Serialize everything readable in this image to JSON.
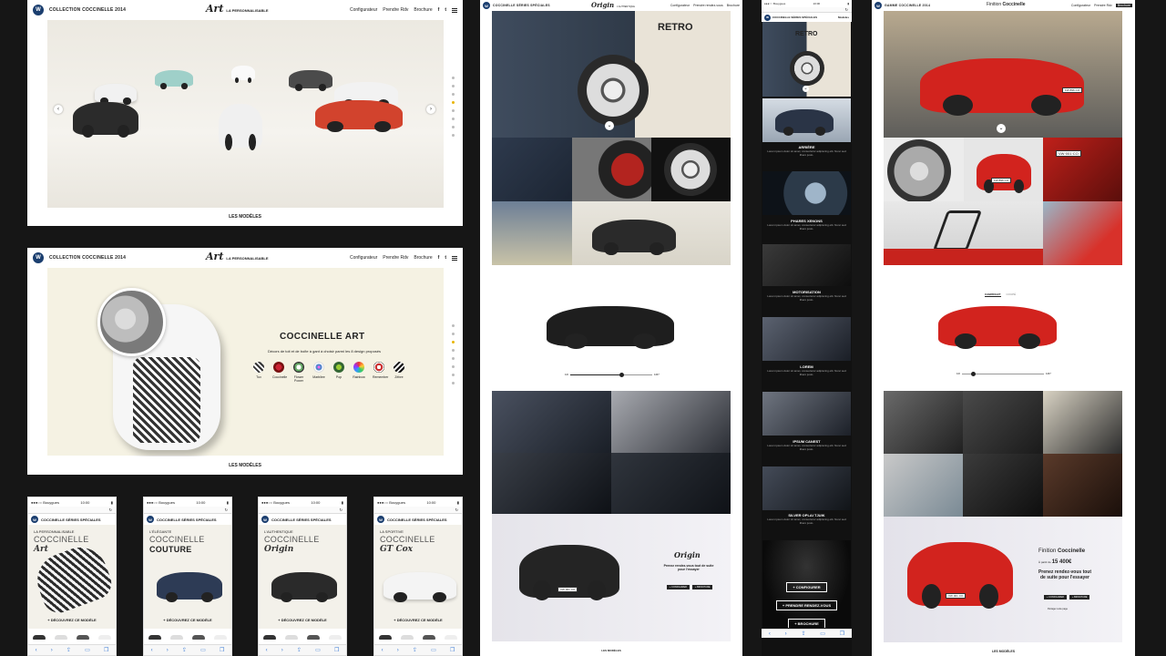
{
  "panel1": {
    "brand": "COLLECTION COCCINELLE 2014",
    "logo_script": "Art",
    "logo_sub": "LA PERSONNALISABLE",
    "nav": [
      "Configurateur",
      "Prendre Rdv",
      "Brochure"
    ],
    "social": [
      "f",
      "t"
    ],
    "prev_icon": "‹",
    "next_icon": "›",
    "footer": "LES MODÈLES"
  },
  "panel2": {
    "brand": "COLLECTION COCCINELLE 2014",
    "logo_script": "Art",
    "logo_sub": "LA PERSONNALISABLE",
    "nav": [
      "Configurateur",
      "Prendre Rdv",
      "Brochure"
    ],
    "social": [
      "f",
      "t"
    ],
    "title": "COCCINELLE ART",
    "subtitle": "Décors de toit et de boîte à gant à choisir parmi les 8 design proposés",
    "designs": [
      "Tux",
      "Coccinelle",
      "Flower Power",
      "Marbilee",
      "Pop",
      "Rainbow",
      "Remember",
      "Zébre"
    ],
    "footer": "LES MODÈLES"
  },
  "phones": [
    {
      "carrier": "●●●○○ Bouygues",
      "time": "10:00",
      "head": "COCCINELLE SÉRIES SPÉCIALES",
      "kicker": "LA PERSONNALISABLE",
      "line1": "COCCINELLE",
      "line2": "Art",
      "cta": "+ DÉCOUVREZ CE MODÈLE"
    },
    {
      "carrier": "●●●○○ Bouygues",
      "time": "10:00",
      "head": "COCCINELLE SÉRIES SPÉCIALES",
      "kicker": "L'ÉLÉGANTE",
      "line1": "COCCINELLE",
      "line2": "COUTURE",
      "cta": "+ DÉCOUVREZ CE MODÈLE"
    },
    {
      "carrier": "●●●○○ Bouygues",
      "time": "10:00",
      "head": "COCCINELLE SÉRIES SPÉCIALES",
      "kicker": "L'AUTHENTIQUE",
      "line1": "COCCINELLE",
      "line2": "Origin",
      "cta": "+ DÉCOUVREZ CE MODÈLE"
    },
    {
      "carrier": "●●●○○ Bouygues",
      "time": "10:00",
      "head": "COCCINELLE SÉRIES SPÉCIALES",
      "kicker": "LA SPORTIVE",
      "line1": "COCCINELLE",
      "line2": "GT Cox",
      "cta": "+ DÉCOUVREZ CE MODÈLE"
    }
  ],
  "panel3": {
    "brand": "COCCINELLE SÉRIES SPÉCIALES",
    "logo_script": "Origin",
    "logo_sub": "L'AUTHENTIQUE",
    "nav": [
      "Configurateur",
      "Prendre rendez-vous",
      "Brochure"
    ],
    "hero_word": "RETRO",
    "slider_left": "1R",
    "slider_right": "1M7",
    "cta_script": "Origin",
    "cta_text": "Prenez rendez-vous tout de suite pour l'essayer",
    "cta_buttons": [
      "+ CONFIGURER",
      "+ BROCHURE"
    ],
    "plate": "VW·001·CO",
    "footer": "LES MODÈLES"
  },
  "panel4": {
    "carrier": "●●●○○ Bouygues",
    "time": "10:00",
    "brand": "COCCINELLE SÉRIES SPÉCIALES",
    "menu": "Modèles",
    "hero_word": "RETRO",
    "sections": [
      "ARRIÈRE",
      "PHARES XENONS",
      "MOTORISATION",
      "LOREM",
      "IPSUM CANEST",
      "SILVER OPLAI TJUIK"
    ],
    "lorem": "Lorem ipsum dolor sit amet, consectetur adipiscing elit. Nunc sed libero justo.",
    "buttons": [
      "+ CONFIGURER",
      "+ PRENDRE RENDEZ-VOUS",
      "+ BROCHURE"
    ]
  },
  "panel5": {
    "brand": "GAMME COCCINELLE 2014",
    "title_prefix": "Finition",
    "title_bold": "Coccinelle",
    "nav": [
      "Configurateur",
      "Prendre Rdv",
      "Brochure"
    ],
    "tabs": [
      "CABRIOLET",
      "COUPÉ"
    ],
    "slider_left": "1R",
    "slider_right": "1M7",
    "plate_top": "FW·896·CO",
    "plate_rear": "FW·896·CO",
    "plate_close": "VW·001·CO",
    "plate_front": "VW·001·CO",
    "cta_title_prefix": "Finition",
    "cta_title_bold": "Coccinelle",
    "price_prefix": "À partir de",
    "price": "15 400€",
    "cta_text": "Prenez rendez-vous tout de suite pour l'essayer",
    "cta_buttons": [
      "+ CONFIGURER",
      "+ BROCHURE"
    ],
    "share": "Partager cette page",
    "footer": "LES MODÈLES"
  }
}
